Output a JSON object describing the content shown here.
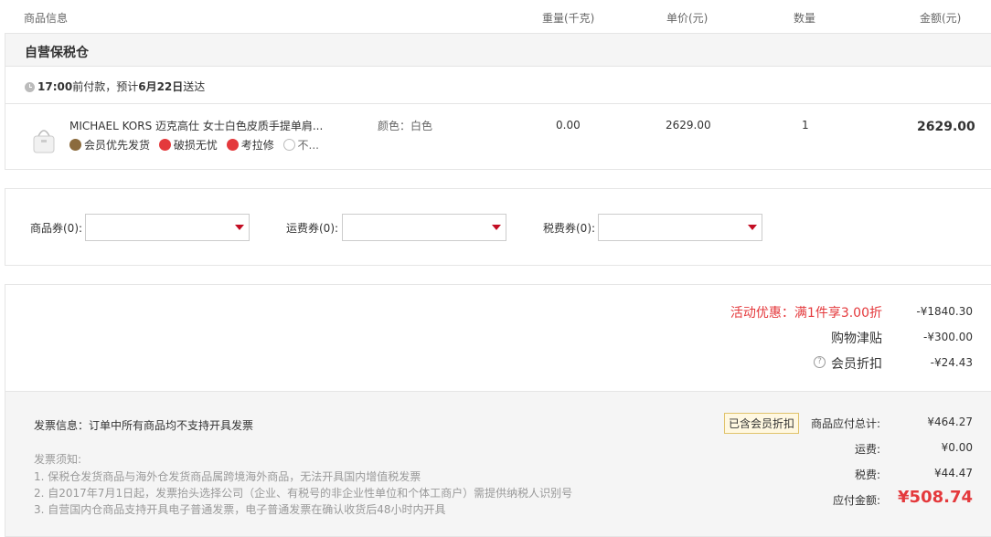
{
  "header": {
    "product_info": "商品信息",
    "weight": "重量(千克)",
    "unit_price": "单价(元)",
    "quantity": "数量",
    "amount": "金额(元)"
  },
  "warehouse": {
    "name": "自营保税仓",
    "delivery_prefix": "17:00",
    "delivery_mid": "前付款，预计",
    "delivery_date": "6月22日",
    "delivery_suffix": "送达"
  },
  "item": {
    "title": "MICHAEL KORS 迈克高仕 女士白色皮质手提单肩...",
    "color": "颜色：白色",
    "weight": "0.00",
    "unit_price": "2629.00",
    "quantity": "1",
    "amount": "2629.00",
    "tags": [
      "会员优先发货",
      "破损无忧",
      "考拉修",
      "不..."
    ]
  },
  "coupons": {
    "goods": "商品券(0):",
    "shipping": "运费券(0):",
    "tax": "税费券(0):"
  },
  "discounts": {
    "activity_label": "活动优惠：满1件享3.00折",
    "activity_value": "-¥1840.30",
    "subsidy_label": "购物津贴",
    "subsidy_value": "-¥300.00",
    "member_label": "会员折扣",
    "member_value": "-¥24.43"
  },
  "invoice": {
    "info": "发票信息：订单中所有商品均不支持开具发票",
    "notes_title": "发票须知:",
    "notes": [
      "1. 保税仓发货商品与海外仓发货商品属跨境海外商品，无法开具国内增值税发票",
      "2. 自2017年7月1日起，发票抬头选择公司（企业、有税号的非企业性单位和个体工商户）需提供纳税人识别号",
      "3. 自营国内仓商品支持开具电子普通发票，电子普通发票在确认收货后48小时内开具"
    ]
  },
  "totals": {
    "member_badge": "已含会员折扣",
    "goods_label": "商品应付总计:",
    "goods_value": "¥464.27",
    "shipping_label": "运费:",
    "shipping_value": "¥0.00",
    "tax_label": "税费:",
    "tax_value": "¥44.47",
    "payable_label": "应付金额:",
    "payable_value": "¥508.74"
  },
  "colors": {
    "accent": "#e4393c",
    "brand_red": "#c30d23"
  }
}
